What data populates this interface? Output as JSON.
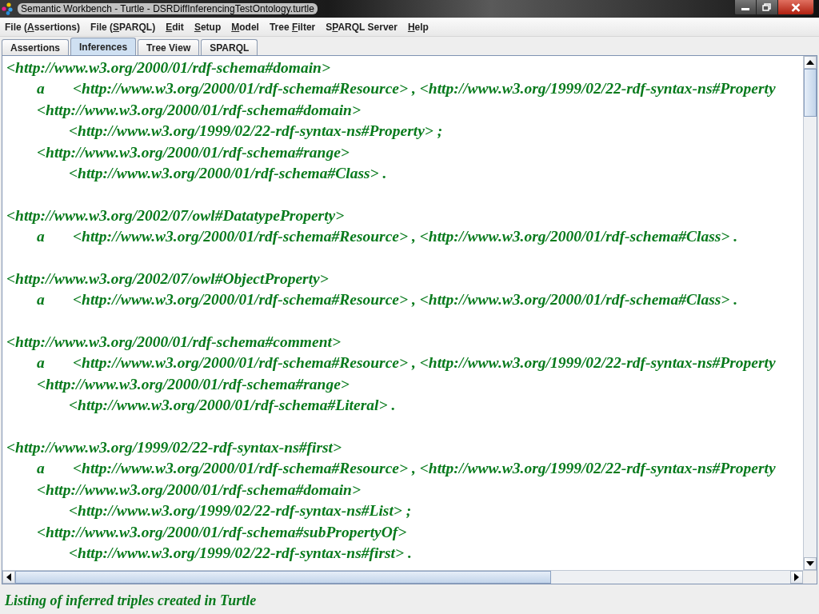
{
  "window": {
    "title": "Semantic Workbench - Turtle - DSRDiffInferencingTestOntology.turtle"
  },
  "menu": [
    {
      "pre": "File (",
      "key": "A",
      "post": "ssertions)"
    },
    {
      "pre": "File (",
      "key": "S",
      "post": "PARQL)"
    },
    {
      "key": "E",
      "post": "dit"
    },
    {
      "key": "S",
      "post": "etup"
    },
    {
      "key": "M",
      "post": "odel"
    },
    {
      "pre": "Tree ",
      "key": "F",
      "post": "ilter"
    },
    {
      "pre": "S",
      "key": "P",
      "post": "ARQL Server"
    },
    {
      "key": "H",
      "post": "elp"
    }
  ],
  "tabs": [
    {
      "label": "Assertions",
      "selected": false
    },
    {
      "label": "Inferences",
      "selected": true
    },
    {
      "label": "Tree View",
      "selected": false
    },
    {
      "label": "SPARQL",
      "selected": false
    }
  ],
  "listing": [
    {
      "subject": "<http://www.w3.org/2000/01/rdf-schema#domain>",
      "properties": [
        {
          "kind": "type",
          "predicate": "a",
          "object": "<http://www.w3.org/2000/01/rdf-schema#Resource> , <http://www.w3.org/1999/02/22-rdf-syntax-ns#Property"
        },
        {
          "kind": "pair",
          "predicate": "<http://www.w3.org/2000/01/rdf-schema#domain>",
          "object": "<http://www.w3.org/1999/02/22-rdf-syntax-ns#Property> ;"
        },
        {
          "kind": "pair",
          "predicate": "<http://www.w3.org/2000/01/rdf-schema#range>",
          "object": "<http://www.w3.org/2000/01/rdf-schema#Class> ."
        }
      ]
    },
    {
      "subject": "<http://www.w3.org/2002/07/owl#DatatypeProperty>",
      "properties": [
        {
          "kind": "type",
          "predicate": "a",
          "object": "<http://www.w3.org/2000/01/rdf-schema#Resource> , <http://www.w3.org/2000/01/rdf-schema#Class> ."
        }
      ]
    },
    {
      "subject": "<http://www.w3.org/2002/07/owl#ObjectProperty>",
      "properties": [
        {
          "kind": "type",
          "predicate": "a",
          "object": "<http://www.w3.org/2000/01/rdf-schema#Resource> , <http://www.w3.org/2000/01/rdf-schema#Class> ."
        }
      ]
    },
    {
      "subject": "<http://www.w3.org/2000/01/rdf-schema#comment>",
      "properties": [
        {
          "kind": "type",
          "predicate": "a",
          "object": "<http://www.w3.org/2000/01/rdf-schema#Resource> , <http://www.w3.org/1999/02/22-rdf-syntax-ns#Property"
        },
        {
          "kind": "pair",
          "predicate": "<http://www.w3.org/2000/01/rdf-schema#range>",
          "object": "<http://www.w3.org/2000/01/rdf-schema#Literal> ."
        }
      ]
    },
    {
      "subject": "<http://www.w3.org/1999/02/22-rdf-syntax-ns#first>",
      "properties": [
        {
          "kind": "type",
          "predicate": "a",
          "object": "<http://www.w3.org/2000/01/rdf-schema#Resource> , <http://www.w3.org/1999/02/22-rdf-syntax-ns#Property"
        },
        {
          "kind": "pair",
          "predicate": "<http://www.w3.org/2000/01/rdf-schema#domain>",
          "object": "<http://www.w3.org/1999/02/22-rdf-syntax-ns#List> ;"
        },
        {
          "kind": "pair",
          "predicate": "<http://www.w3.org/2000/01/rdf-schema#subPropertyOf>",
          "object": "<http://www.w3.org/1999/02/22-rdf-syntax-ns#first> ."
        }
      ]
    }
  ],
  "status_bar": "Listing of inferred triples created in Turtle"
}
